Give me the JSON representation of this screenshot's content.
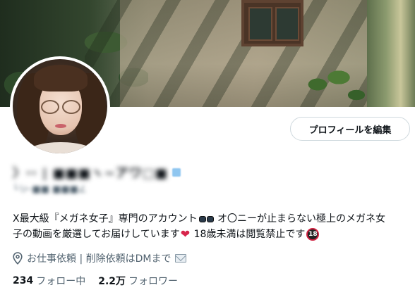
{
  "profile": {
    "edit_button_label": "プロフィールを編集",
    "bio_line1_a": "X最大級『メガネ女子』専門のアカウント",
    "bio_line1_b": " オ〇ニーが止まらない極上のメガネ女",
    "bio_line2_a": "子の動画を厳選してお届けしています",
    "bio_line2_b": " 18歳未満は閲覧禁止です",
    "emoji_18_text": "18",
    "location_text": "お仕事依頼 | 削除依頼はDMまで",
    "following_count": "234",
    "following_label": "フォロー中",
    "followers_count": "2.2万",
    "followers_label": "フォロワー"
  },
  "colors": {
    "text_primary": "#0f1419",
    "text_secondary": "#536471",
    "button_border": "#cfd9de"
  },
  "icons": {
    "location": "map-pin-icon",
    "glasses": "glasses-emoji",
    "heart": "heart-emoji",
    "no_under_18": "no-under-18-emoji",
    "mail": "envelope-emoji",
    "verified": "verified-badge"
  }
}
